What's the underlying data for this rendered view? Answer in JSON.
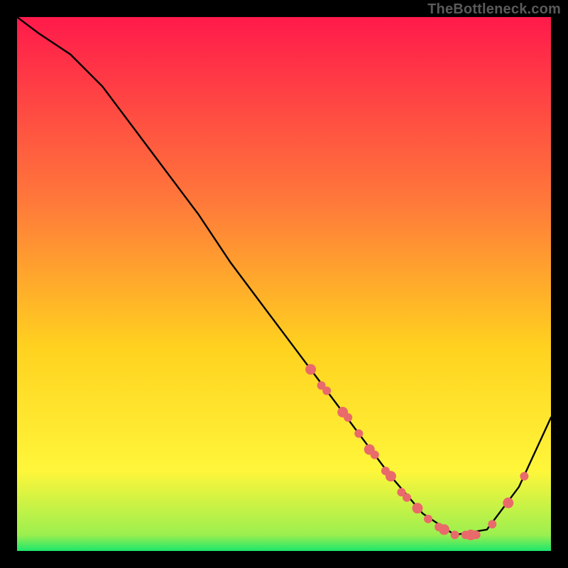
{
  "attribution": "TheBottleneck.com",
  "colors": {
    "gradient_top": "#ff1a4b",
    "gradient_mid1": "#ff6a3a",
    "gradient_mid2": "#ffd21f",
    "gradient_mid3": "#fff63a",
    "gradient_bottom": "#1de66c",
    "curve": "#000000",
    "marker": "#e96a6a",
    "frame": "#000000"
  },
  "chart_data": {
    "type": "line",
    "title": "",
    "xlabel": "",
    "ylabel": "",
    "xlim": [
      0,
      100
    ],
    "ylim": [
      0,
      100
    ],
    "grid": false,
    "series": [
      {
        "name": "curve",
        "x": [
          0,
          4,
          10,
          16,
          22,
          28,
          34,
          40,
          46,
          52,
          58,
          64,
          70,
          76,
          82,
          88,
          94,
          100
        ],
        "y": [
          100,
          97,
          93,
          87,
          79,
          71,
          63,
          54,
          46,
          38,
          30,
          22,
          14,
          7,
          3,
          4,
          12,
          25
        ]
      }
    ],
    "markers": {
      "name": "highlighted-points",
      "color": "#e96a6a",
      "x": [
        55,
        57,
        58,
        61,
        62,
        64,
        66,
        67,
        69,
        70,
        72,
        73,
        75,
        77,
        79,
        80,
        82,
        84,
        85,
        86,
        89,
        92,
        95
      ],
      "y": [
        34,
        31,
        30,
        26,
        25,
        22,
        19,
        18,
        15,
        14,
        11,
        10,
        8,
        6,
        4.5,
        4,
        3,
        3,
        3,
        3,
        5,
        9,
        14
      ]
    }
  }
}
